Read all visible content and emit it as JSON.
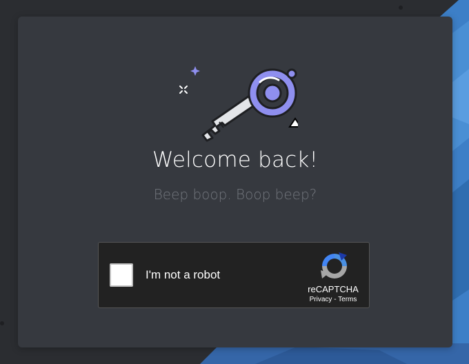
{
  "login": {
    "title": "Welcome back!",
    "subtitle": "Beep boop. Boop beep?"
  },
  "recaptcha": {
    "label": "I'm not a robot",
    "brand": "reCAPTCHA",
    "privacy": "Privacy",
    "separator": " - ",
    "terms": "Terms"
  },
  "colors": {
    "background": "#2b2d31",
    "card": "#36393f",
    "accent": "#8f8fef",
    "subtitle": "#72767d"
  }
}
